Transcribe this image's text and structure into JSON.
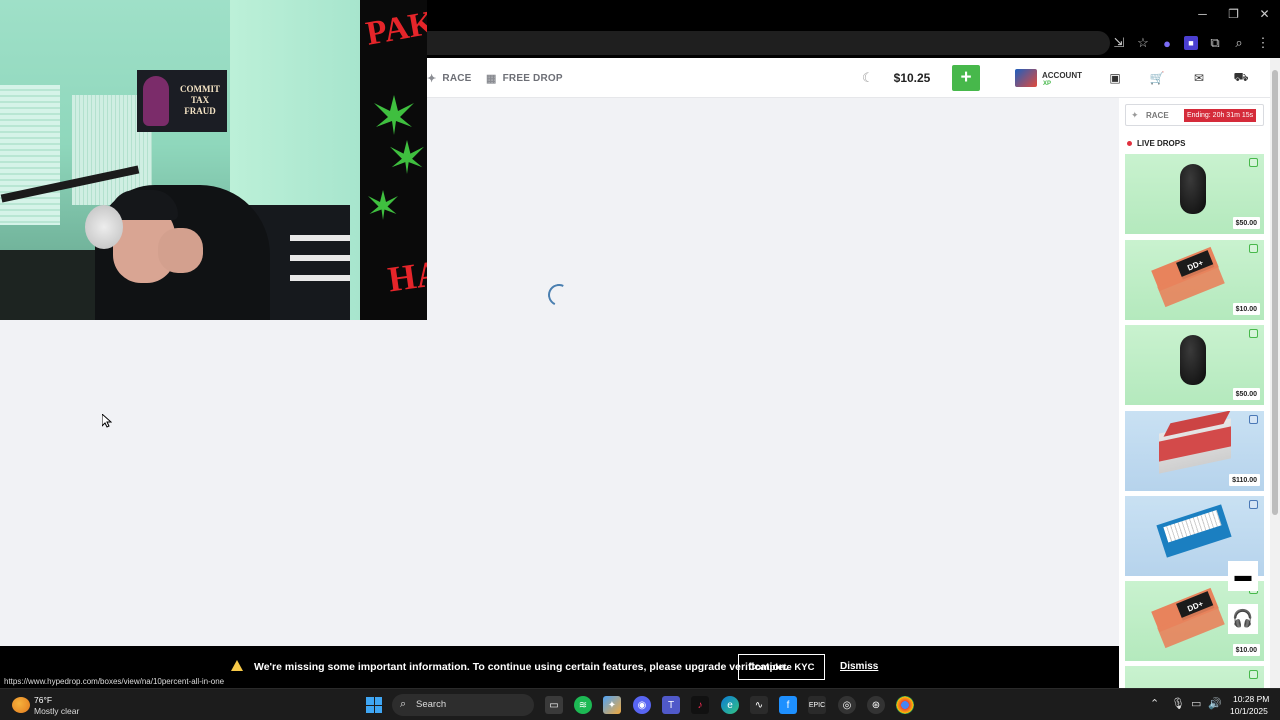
{
  "browser": {
    "window_controls": {
      "minimize": "─",
      "restore": "❐",
      "close": "✕"
    },
    "toolbar_icons": [
      "install-icon",
      "star-icon",
      "extension-icon",
      "extension-icon",
      "puzzle-icon",
      "sidebar-search-icon",
      "menu-icon"
    ]
  },
  "header": {
    "race_label": "RACE",
    "free_drop_label": "FREE DROP",
    "balance": "$10.25",
    "deposit_symbol": "+",
    "account_label": "ACCOUNT",
    "xp_label": "XP"
  },
  "sidebar": {
    "race_label": "RACE",
    "race_ending": "Ending: 20h 31m 15s",
    "live_drops_label": "LIVE DROPS",
    "drops": [
      {
        "item": "mouse",
        "price": "$50.00",
        "color": "#c9f2cf"
      },
      {
        "item": "pouch",
        "price": "$10.00",
        "color": "#c9f2cf"
      },
      {
        "item": "mouse",
        "price": "$50.00",
        "color": "#c9f2cf"
      },
      {
        "item": "cash",
        "price": "$110.00",
        "color": "#c9e1f3"
      },
      {
        "item": "cards",
        "price": "",
        "color": "#c9e1f3"
      },
      {
        "item": "pouch",
        "price": "$10.00",
        "color": "#c9f2cf"
      }
    ],
    "pouch_tag": "DD+"
  },
  "kyc_banner": {
    "message": "We're missing some important information. To continue using certain features, please upgrade verification.",
    "complete_button": "Complete KYC",
    "dismiss_button": "Dismiss"
  },
  "status_url": "https://www.hypedrop.com/boxes/view/na/10percent-all-in-one",
  "webcam": {
    "flag_text": "COMMIT TAX FRAUD",
    "tapestry_top": "PAK",
    "tapestry_bottom": "HA"
  },
  "taskbar": {
    "temperature": "76°F",
    "weather": "Mostly clear",
    "search_label": "Search",
    "time": "10:28 PM",
    "date": "10/1/2025"
  },
  "colors": {
    "deposit_green": "#47b84b",
    "ending_red": "#d52b3a",
    "kyc_warning": "#f7c948"
  }
}
